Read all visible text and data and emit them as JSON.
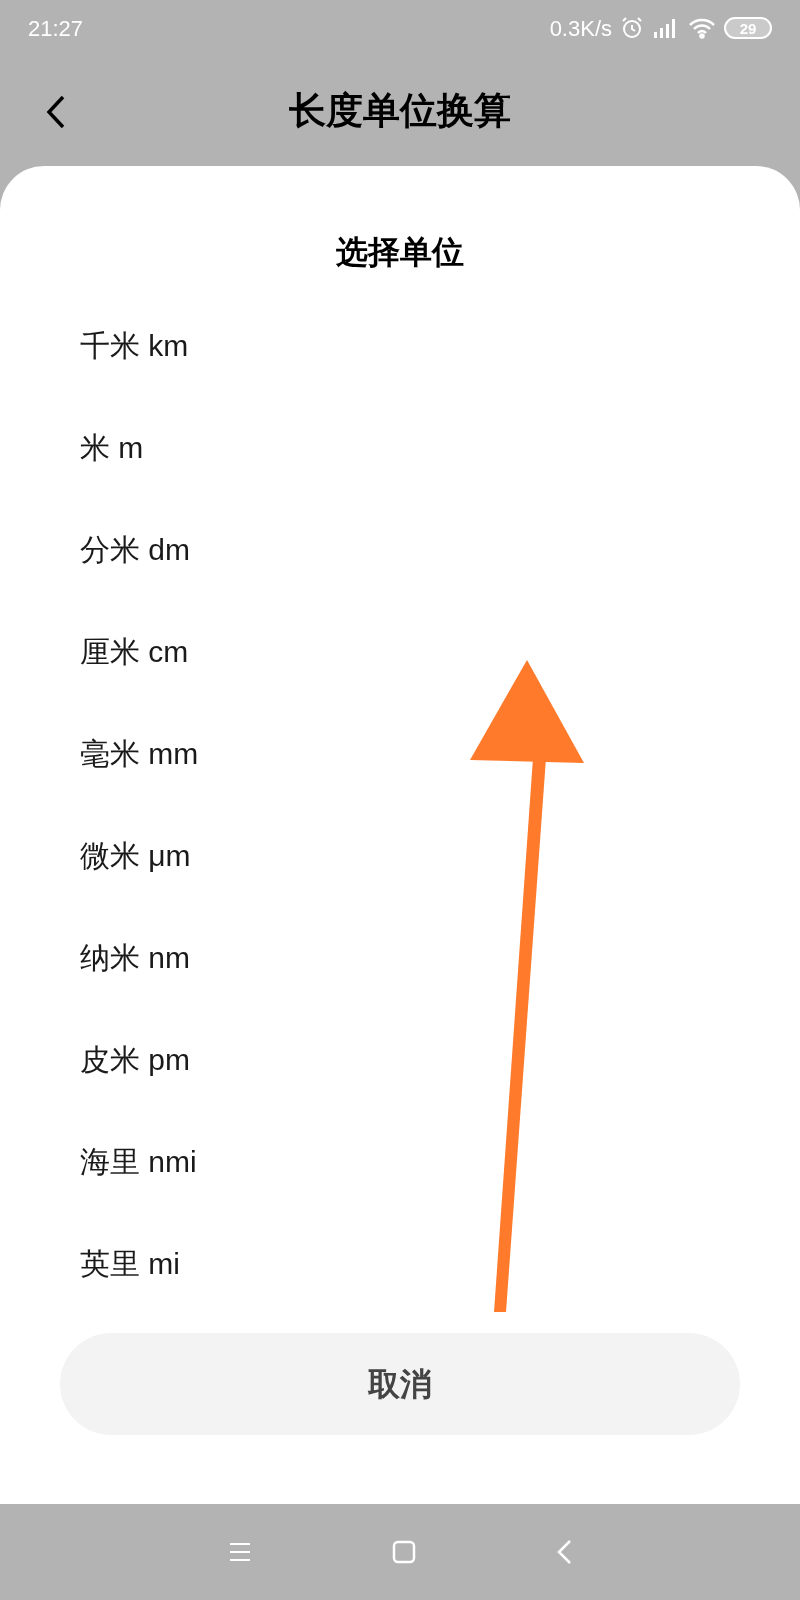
{
  "status_bar": {
    "time": "21:27",
    "speed": "0.3K/s",
    "battery": "29"
  },
  "header": {
    "title": "长度单位换算"
  },
  "sheet": {
    "title": "选择单位",
    "units": [
      {
        "label": "千米 km"
      },
      {
        "label": "米 m"
      },
      {
        "label": "分米 dm"
      },
      {
        "label": "厘米 cm"
      },
      {
        "label": "毫米 mm"
      },
      {
        "label": "微米 μm"
      },
      {
        "label": "纳米 nm"
      },
      {
        "label": "皮米 pm"
      },
      {
        "label": "海里 nmi"
      },
      {
        "label": "英里 mi"
      }
    ],
    "cancel": "取消"
  }
}
